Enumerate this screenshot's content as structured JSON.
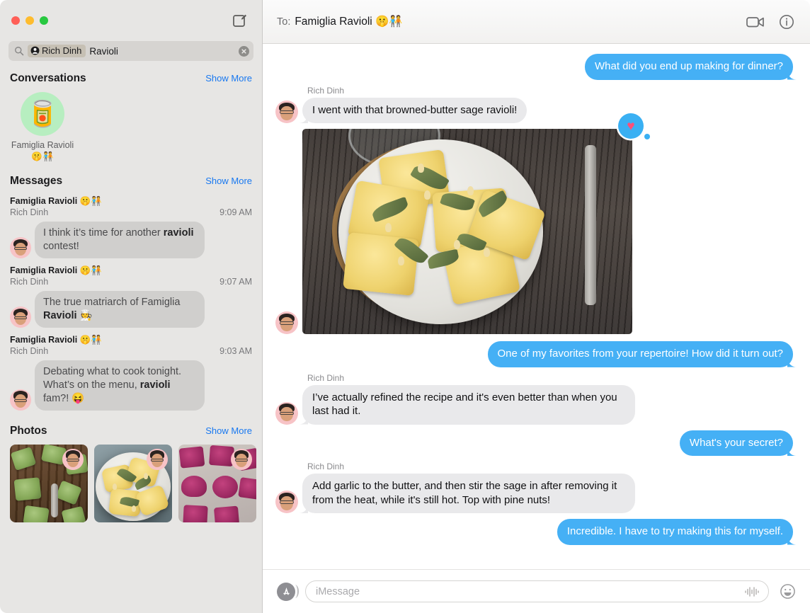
{
  "window": {
    "traffic_lights": [
      "close",
      "minimize",
      "zoom"
    ],
    "compose_icon": "compose-icon"
  },
  "search": {
    "icon": "search-icon",
    "token_label": "Rich Dinh",
    "token_icon": "contact-icon",
    "query_text": "Ravioli",
    "clear_icon": "clear-icon",
    "placeholder": "Search"
  },
  "sidebar": {
    "sections": {
      "conversations": {
        "title": "Conversations",
        "show_more": "Show More",
        "items": [
          {
            "avatar_emoji": "🥫",
            "label": "Famiglia Ravioli 🤫🧑‍🤝‍🧑"
          }
        ]
      },
      "messages": {
        "title": "Messages",
        "show_more": "Show More",
        "results": [
          {
            "conversation": "Famiglia Ravioli 🤫🧑‍🤝‍🧑",
            "sender": "Rich Dinh",
            "time": "9:09 AM",
            "text_before": "I think it’s time for another ",
            "text_match": "ravioli",
            "text_after": " contest!"
          },
          {
            "conversation": "Famiglia Ravioli 🤫🧑‍🤝‍🧑",
            "sender": "Rich Dinh",
            "time": "9:07 AM",
            "text_before": "The true matriarch of Famiglia ",
            "text_match": "Ravioli",
            "text_after": " 🧑‍🍳"
          },
          {
            "conversation": "Famiglia Ravioli 🤫🧑‍🤝‍🧑",
            "sender": "Rich Dinh",
            "time": "9:03 AM",
            "text_before": "Debating what to cook tonight. What’s on the menu, ",
            "text_match": "ravioli",
            "text_after": " fam?! 😝"
          }
        ]
      },
      "photos": {
        "title": "Photos",
        "show_more": "Show More",
        "items": [
          {
            "alt": "green spinach ravioli on wooden board with fork"
          },
          {
            "alt": "sage butter ravioli on plate"
          },
          {
            "alt": "beet magenta ravioli dusted with flour"
          }
        ]
      }
    }
  },
  "chat": {
    "header": {
      "to_label": "To:",
      "recipient": "Famiglia Ravioli 🤫🧑‍🤝‍🧑",
      "facetime_icon": "video-camera-icon",
      "info_icon": "info-icon"
    },
    "messages": [
      {
        "type": "text",
        "direction": "out",
        "text": "What did you end up making for dinner?"
      },
      {
        "type": "text",
        "direction": "in",
        "sender": "Rich Dinh",
        "text": "I went with that browned-butter sage ravioli!"
      },
      {
        "type": "photo",
        "direction": "in",
        "alt": "plate of sage butter ravioli with pine nuts on weathered wood table with fork",
        "tapback": "heart"
      },
      {
        "type": "text",
        "direction": "out",
        "text": "One of my favorites from your repertoire! How did it turn out?"
      },
      {
        "type": "text",
        "direction": "in",
        "sender": "Rich Dinh",
        "text": "I’ve actually refined the recipe and it's even better than when you last had it."
      },
      {
        "type": "text",
        "direction": "out",
        "text": "What's your secret?"
      },
      {
        "type": "text",
        "direction": "in",
        "sender": "Rich Dinh",
        "text": "Add garlic to the butter, and then stir the sage in after removing it from the heat, while it's still hot. Top with pine nuts!"
      },
      {
        "type": "text",
        "direction": "out",
        "text": "Incredible. I have to try making this for myself."
      }
    ],
    "compose": {
      "apps_icon": "app-store-icon",
      "placeholder": "iMessage",
      "value": "",
      "audio_icon": "audio-waveform-icon",
      "emoji_icon": "emoji-smiley-icon"
    }
  },
  "colors": {
    "accent_blue": "#45b0f5",
    "link_blue": "#1878f0",
    "sidebar_bg": "#e7e6e4",
    "incoming_bubble": "#e9e9eb",
    "sidebar_bubble": "#d0cfcd",
    "tapback_heart": "#ff4f79"
  }
}
